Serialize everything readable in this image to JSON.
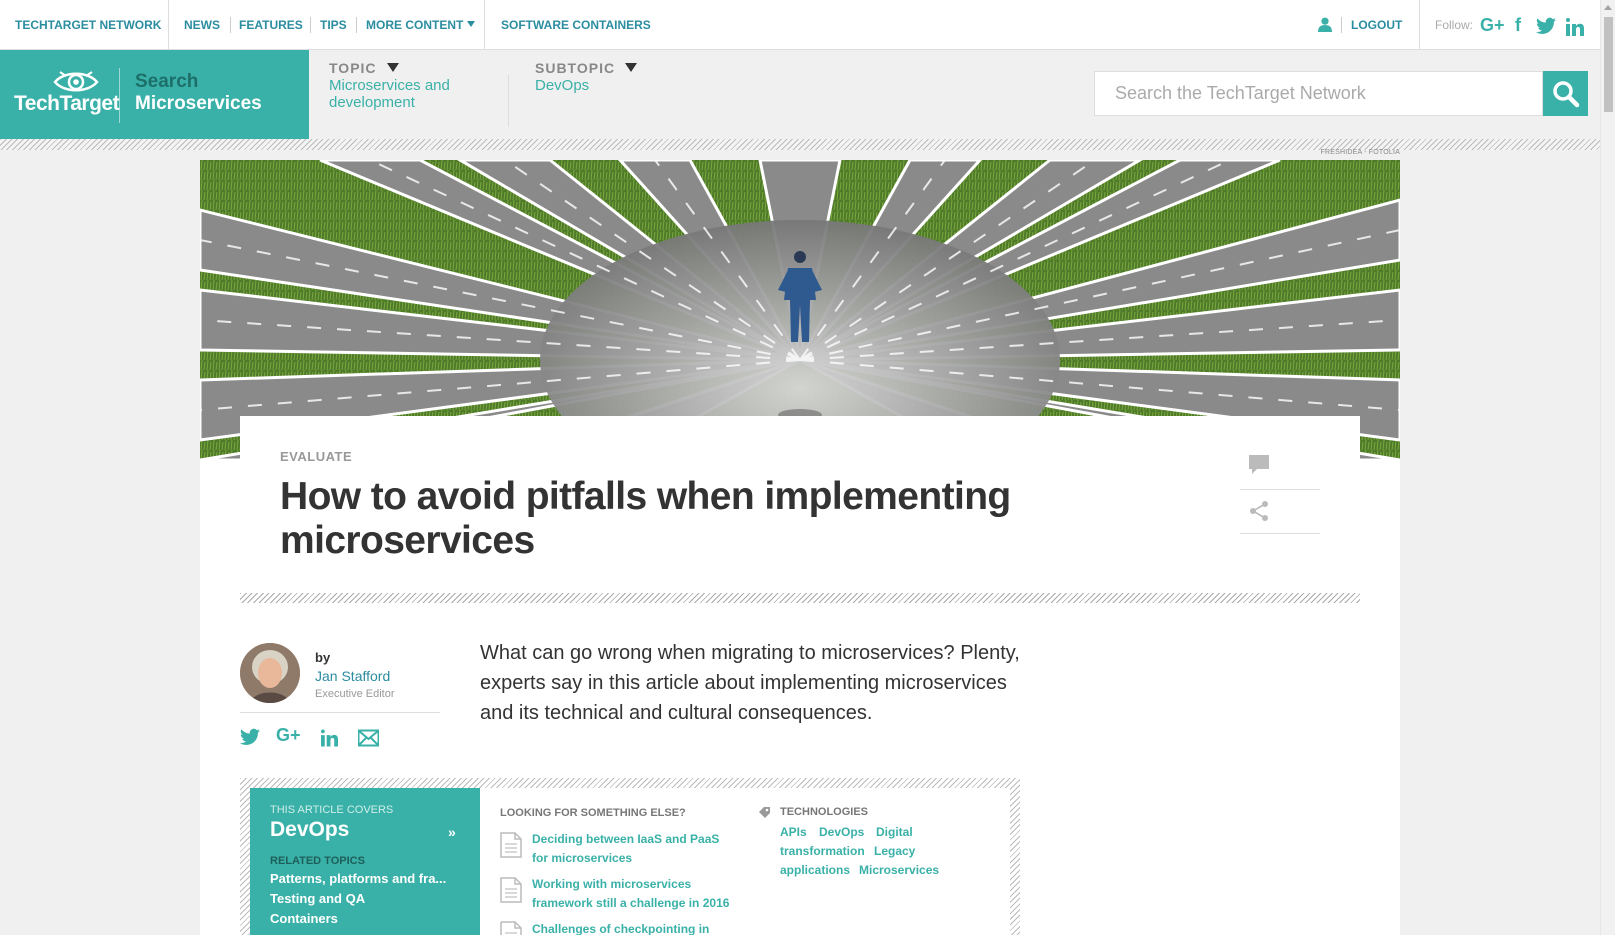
{
  "topnav": {
    "network": "TECHTARGET NETWORK",
    "links": [
      "NEWS",
      "FEATURES",
      "TIPS",
      "MORE CONTENT"
    ],
    "site_link": "SOFTWARE CONTAINERS",
    "logout": "LOGOUT",
    "follow": "Follow:",
    "social": [
      "google-plus-icon",
      "facebook-icon",
      "twitter-icon",
      "linkedin-icon"
    ]
  },
  "brand": {
    "logo": "TechTarget",
    "site_line1": "Search",
    "site_line2": "Microservices"
  },
  "breadcrumb": {
    "topic_label": "TOPIC",
    "topic_value": "Microservices and development",
    "subtopic_label": "SUBTOPIC",
    "subtopic_value": "DevOps"
  },
  "search": {
    "placeholder": "Search the TechTarget Network"
  },
  "hero": {
    "credit": "FRESHIDEA - FOTOLIA"
  },
  "article": {
    "kicker": "EVALUATE",
    "title": "How to avoid pitfalls when implementing microservices",
    "byline_prefix": "by",
    "author": "Jan Stafford",
    "author_role": "Executive Editor",
    "lede": "What can go wrong when migrating to microservices? Plenty, experts say in this article about implementing microservices and its technical and cultural consequences."
  },
  "covers": {
    "label": "THIS ARTICLE COVERS",
    "topic": "DevOps",
    "related_label": "RELATED TOPICS",
    "related": [
      "Patterns, platforms and fra...",
      "Testing and QA",
      "Containers"
    ]
  },
  "looking": {
    "heading": "LOOKING FOR SOMETHING ELSE?",
    "links": [
      "Deciding between IaaS and PaaS for microservices",
      "Working with microservices framework still a challenge in 2016",
      "Challenges of checkpointing in"
    ]
  },
  "technologies": {
    "heading": "TECHNOLOGIES",
    "tags": [
      "APIs",
      "DevOps",
      "Digital",
      "transformation",
      "Legacy",
      "applications",
      "Microservices"
    ]
  },
  "colors": {
    "teal": "#3ab1a8",
    "link": "#2b8da0",
    "dark_teal": "#1d6f69"
  }
}
